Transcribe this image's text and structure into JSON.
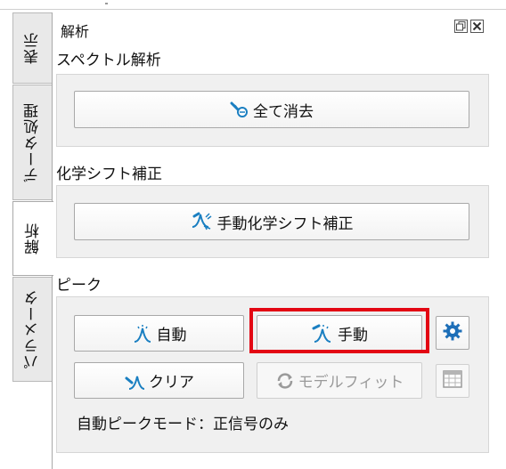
{
  "tabs": [
    {
      "label": "表示",
      "active": false
    },
    {
      "label": "データ処理",
      "active": false
    },
    {
      "label": "解析",
      "active": true
    },
    {
      "label": "パラメータ",
      "active": false
    }
  ],
  "panel": {
    "title": "解析",
    "float_icon": "float-window-icon",
    "close_icon": "close-icon"
  },
  "spectrum": {
    "title": "スペクトル解析",
    "clear_all_label": "全て消去",
    "clear_all_icon": "eraser-icon"
  },
  "chemical_shift": {
    "title": "化学シフト補正",
    "manual_label": "手動化学シフト補正",
    "manual_icon": "peak-shift-icon"
  },
  "peak": {
    "title": "ピーク",
    "auto_label": "自動",
    "manual_label": "手動",
    "clear_label": "クリア",
    "model_fit_label": "モデルフィット",
    "settings_icon": "gear-icon",
    "calendar_icon": "table-icon",
    "mode_text": "自動ピークモード：正信号のみ"
  },
  "colors": {
    "accent_blue": "#1a7fc1",
    "highlight_red": "#e30613",
    "gear_blue": "#1e6fb8"
  }
}
